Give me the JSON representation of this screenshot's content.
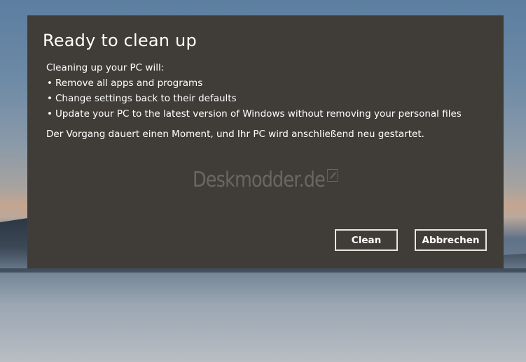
{
  "dialog": {
    "title": "Ready to clean up",
    "intro": "Cleaning up your PC will:",
    "bullet_glyph": "•",
    "items": [
      "Remove all apps and programs",
      "Change settings back to their defaults",
      "Update your PC to the latest version of Windows without removing your personal files"
    ],
    "notice": "Der Vorgang dauert einen Moment, und Ihr PC wird anschließend neu gestartet.",
    "watermark": "Deskmodder.de",
    "buttons": {
      "clean_label": "Clean",
      "cancel_label": "Abbrechen"
    }
  },
  "colors": {
    "dialog_bg": "#403d39",
    "text": "#ffffff",
    "button_border": "#e8e6e3"
  },
  "icons": {
    "watermark_icon": "pencil-square-icon"
  }
}
